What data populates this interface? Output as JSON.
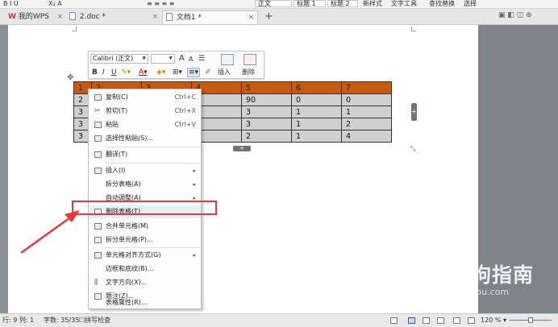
{
  "ribbon": {
    "styles": [
      "正文",
      "标题 1",
      "标题 2"
    ],
    "new_style": "新样式",
    "text_tools": "文字工具",
    "find_replace": "查找替换",
    "select": "选择"
  },
  "tabs": {
    "home": "我的WPS",
    "doc1": "2.doc *",
    "doc2": "文档1 *",
    "add": "+"
  },
  "mini_toolbar": {
    "font_name": "Calibri (正文)",
    "font_size": "",
    "grow_font": "A",
    "shrink_font": "A",
    "bold": "B",
    "italic": "I",
    "underline": "U",
    "insert": "插入",
    "delete": "删除"
  },
  "table": {
    "header": [
      "1",
      "2",
      "3",
      "4",
      "5",
      "6",
      "7"
    ],
    "rows": [
      [
        "2",
        "",
        "",
        "8",
        "90",
        "0",
        "0"
      ],
      [
        "3",
        "",
        "",
        "3",
        "3",
        "1",
        "1"
      ],
      [
        "3",
        "",
        "",
        "3",
        "3",
        "1",
        "2"
      ],
      [
        "3",
        "",
        "",
        "3",
        "2",
        "1",
        "4"
      ]
    ]
  },
  "context_menu": {
    "items": [
      {
        "icon": "copy-icon",
        "label": "复制(C)",
        "shortcut": "Ctrl+C"
      },
      {
        "icon": "cut-icon",
        "label": "剪切(T)",
        "shortcut": "Ctrl+X"
      },
      {
        "icon": "paste-icon",
        "label": "粘贴",
        "shortcut": "Ctrl+V"
      },
      {
        "icon": "paste-special-icon",
        "label": "选择性粘贴(S)..."
      },
      {
        "icon": "translate-icon",
        "label": "翻译(T)"
      },
      {
        "icon": "insert-table-icon",
        "label": "插入(I)"
      },
      {
        "label": "拆分表格(A)"
      },
      {
        "label": "自动调整(A)"
      },
      {
        "icon": "delete-table-icon",
        "label": "删除表格(T)"
      },
      {
        "icon": "merge-cells-icon",
        "label": "合并单元格(M)"
      },
      {
        "icon": "split-cells-icon",
        "label": "拆分单元格(P)..."
      },
      {
        "icon": "cell-align-icon",
        "label": "单元格对齐方式(G)"
      },
      {
        "label": "边框和底纹(B)..."
      },
      {
        "icon": "text-direction-icon",
        "label": "文字方向(X)..."
      },
      {
        "icon": "caption-icon",
        "label": "题注(Z)..."
      },
      {
        "label": "表格属性(R)..."
      }
    ]
  },
  "watermark": {
    "text": "搜狗指南",
    "url": "zhinan.sogou.com"
  },
  "status_bar": {
    "position": "行: 9 列: 1",
    "word_count": "字数: 35/35",
    "spell_check": "拼写检查",
    "zoom": "120 %"
  },
  "colors": {
    "header_fill": "#c55a11",
    "body_fill": "#d0d0d0",
    "highlight_box": "#e53935",
    "arrow": "#e53935"
  }
}
